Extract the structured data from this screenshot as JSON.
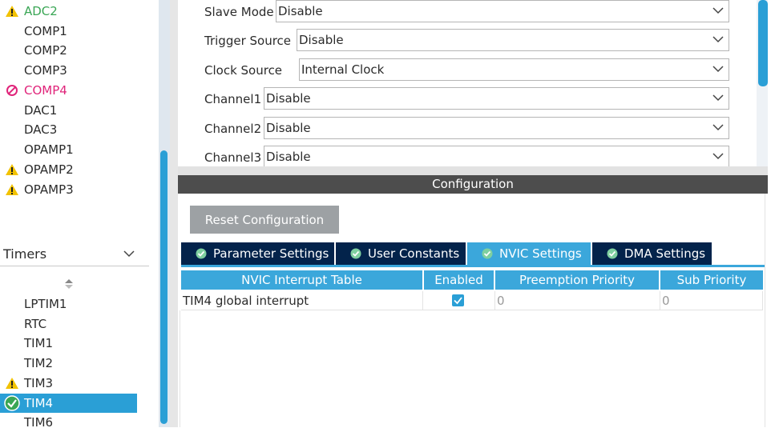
{
  "left_panel": {
    "items_top": [
      {
        "label": "ADC2",
        "status": "warning",
        "color": "#3aa655"
      },
      {
        "label": "COMP1",
        "status": "none"
      },
      {
        "label": "COMP2",
        "status": "none"
      },
      {
        "label": "COMP3",
        "status": "none"
      },
      {
        "label": "COMP4",
        "status": "disabled",
        "color": "#e0247a"
      },
      {
        "label": "DAC1",
        "status": "none"
      },
      {
        "label": "DAC3",
        "status": "none"
      },
      {
        "label": "OPAMP1",
        "status": "none"
      },
      {
        "label": "OPAMP2",
        "status": "warning"
      },
      {
        "label": "OPAMP3",
        "status": "warning"
      }
    ],
    "category": "Timers",
    "items_timers": [
      {
        "label": "LPTIM1",
        "status": "none"
      },
      {
        "label": "RTC",
        "status": "none"
      },
      {
        "label": "TIM1",
        "status": "none"
      },
      {
        "label": "TIM2",
        "status": "none"
      },
      {
        "label": "TIM3",
        "status": "warning"
      },
      {
        "label": "TIM4",
        "status": "ok",
        "selected": true
      },
      {
        "label": "TIM6",
        "status": "none"
      }
    ]
  },
  "mode": {
    "rows": [
      {
        "label": "Slave Mode",
        "value": "Disable"
      },
      {
        "label": "Trigger Source",
        "value": "Disable"
      },
      {
        "label": "Clock Source",
        "value": "Internal Clock"
      },
      {
        "label": "Channel1",
        "value": "Disable"
      },
      {
        "label": "Channel2",
        "value": "Disable"
      },
      {
        "label": "Channel3",
        "value": "Disable"
      }
    ]
  },
  "configuration": {
    "title": "Configuration",
    "reset_label": "Reset Configuration",
    "tabs": [
      {
        "label": "Parameter Settings",
        "active": false
      },
      {
        "label": "User Constants",
        "active": false
      },
      {
        "label": "NVIC Settings",
        "active": true
      },
      {
        "label": "DMA Settings",
        "active": false
      }
    ],
    "table": {
      "headers": [
        "NVIC Interrupt Table",
        "Enabled",
        "Preemption Priority",
        "Sub Priority"
      ],
      "rows": [
        {
          "name": "TIM4 global interrupt",
          "enabled": true,
          "preemption": "0",
          "sub": "0"
        }
      ]
    }
  },
  "colors": {
    "accent": "#3ba7db",
    "tab_dark": "#03234b",
    "warning": "#f2c200",
    "ok": "#3aa655",
    "disabled": "#e0247a"
  }
}
